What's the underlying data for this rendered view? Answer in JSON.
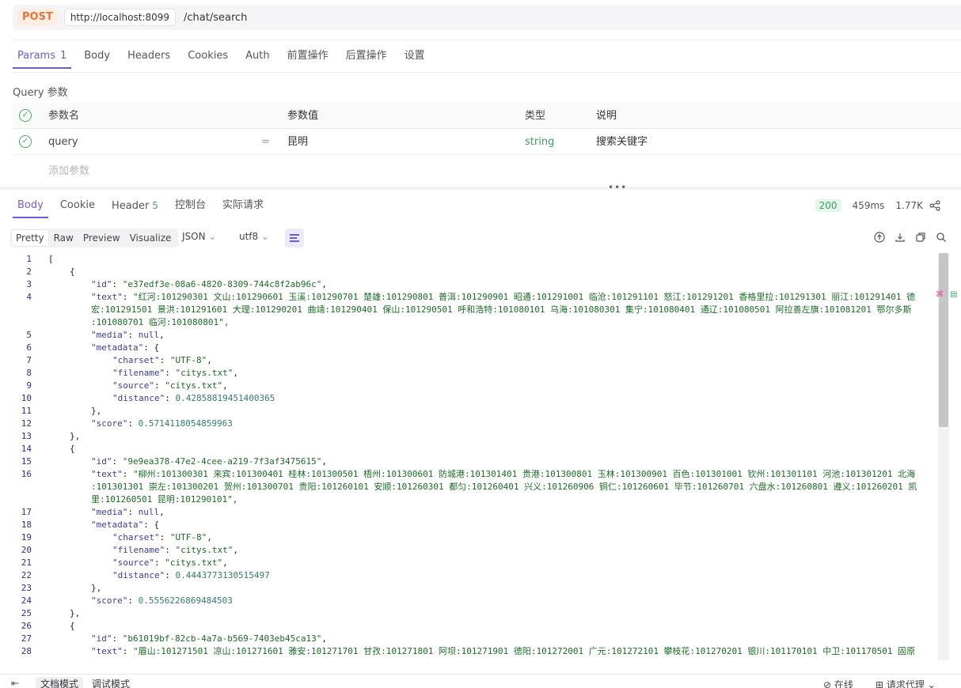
{
  "request": {
    "method": "POST",
    "host": "http://localhost:8099",
    "path": "/chat/search",
    "tabs": [
      {
        "label": "Params",
        "count": "1"
      },
      {
        "label": "Body"
      },
      {
        "label": "Headers"
      },
      {
        "label": "Cookies"
      },
      {
        "label": "Auth"
      },
      {
        "label": "前置操作"
      },
      {
        "label": "后置操作"
      },
      {
        "label": "设置"
      }
    ],
    "query_title": "Query 参数",
    "columns": {
      "name": "参数名",
      "value": "参数值",
      "type": "类型",
      "desc": "说明"
    },
    "param": {
      "name": "query",
      "eq": "=",
      "value": "昆明",
      "type": "string",
      "desc": "搜索关键字"
    },
    "add_param": "添加参数"
  },
  "response": {
    "tabs": [
      {
        "label": "Body"
      },
      {
        "label": "Cookie"
      },
      {
        "label": "Header",
        "count": "5"
      },
      {
        "label": "控制台"
      },
      {
        "label": "实际请求"
      }
    ],
    "status": "200",
    "time": "459ms",
    "size": "1.77K",
    "view_modes": [
      "Pretty",
      "Raw",
      "Preview",
      "Visualize"
    ],
    "format": "JSON",
    "encoding": "utf8"
  },
  "code_lines": [
    {
      "n": "1",
      "i": 0,
      "t": "["
    },
    {
      "n": "2",
      "i": 1,
      "t": "{"
    },
    {
      "n": "3",
      "i": 2,
      "k": "\"id\"",
      "v": "\"e37edf3e-08a6-4820-8309-744c8f2ab96c\"",
      "vt": "s",
      "e": ","
    },
    {
      "n": "4",
      "i": 2,
      "k": "\"text\"",
      "v": "\"红河:101290301 文山:101290601 玉溪:101290701 楚雄:101290801 普洱:101290901 昭通:101291001 临沧:101291101 怒江:101291201 香格里拉:101291301 丽江:101291401 德",
      "vt": "s"
    },
    {
      "n": "",
      "i": 2,
      "cont": "宏:101291501 景洪:101291601 大理:101290201 曲靖:101290401 保山:101290501 呼和浩特:101080101 乌海:101080301 集宁:101080401 通辽:101080501 阿拉善左旗:101081201 鄂尔多斯"
    },
    {
      "n": "",
      "i": 2,
      "cont": ":101080701 临河:101080801\","
    },
    {
      "n": "5",
      "i": 2,
      "k": "\"media\"",
      "v": "null",
      "vt": "k",
      "e": ","
    },
    {
      "n": "6",
      "i": 2,
      "k": "\"metadata\"",
      "v": "{",
      "vt": "p"
    },
    {
      "n": "7",
      "i": 3,
      "k": "\"charset\"",
      "v": "\"UTF-8\"",
      "vt": "s",
      "e": ","
    },
    {
      "n": "8",
      "i": 3,
      "k": "\"filename\"",
      "v": "\"citys.txt\"",
      "vt": "s",
      "e": ","
    },
    {
      "n": "9",
      "i": 3,
      "k": "\"source\"",
      "v": "\"citys.txt\"",
      "vt": "s",
      "e": ","
    },
    {
      "n": "10",
      "i": 3,
      "k": "\"distance\"",
      "v": "0.42858819451400365",
      "vt": "n"
    },
    {
      "n": "11",
      "i": 2,
      "t": "},"
    },
    {
      "n": "12",
      "i": 2,
      "k": "\"score\"",
      "v": "0.5714118054859963",
      "vt": "n"
    },
    {
      "n": "13",
      "i": 1,
      "t": "},"
    },
    {
      "n": "14",
      "i": 1,
      "t": "{"
    },
    {
      "n": "15",
      "i": 2,
      "k": "\"id\"",
      "v": "\"9e9ea378-47e2-4cee-a219-7f3af3475615\"",
      "vt": "s",
      "e": ","
    },
    {
      "n": "16",
      "i": 2,
      "k": "\"text\"",
      "v": "\"柳州:101300301 来宾:101300401 桂林:101300501 梧州:101300601 防城港:101301401 贵港:101300801 玉林:101300901 百色:101301001 钦州:101301101 河池:101301201 北海",
      "vt": "s"
    },
    {
      "n": "",
      "i": 2,
      "cont": ":101301301 崇左:101300201 贺州:101300701 贵阳:101260101 安顺:101260301 都匀:101260401 兴义:101260906 铜仁:101260601 毕节:101260701 六盘水:101260801 遵义:101260201 凯"
    },
    {
      "n": "",
      "i": 2,
      "cont": "里:101260501 昆明:101290101\","
    },
    {
      "n": "17",
      "i": 2,
      "k": "\"media\"",
      "v": "null",
      "vt": "k",
      "e": ","
    },
    {
      "n": "18",
      "i": 2,
      "k": "\"metadata\"",
      "v": "{",
      "vt": "p"
    },
    {
      "n": "19",
      "i": 3,
      "k": "\"charset\"",
      "v": "\"UTF-8\"",
      "vt": "s",
      "e": ","
    },
    {
      "n": "20",
      "i": 3,
      "k": "\"filename\"",
      "v": "\"citys.txt\"",
      "vt": "s",
      "e": ","
    },
    {
      "n": "21",
      "i": 3,
      "k": "\"source\"",
      "v": "\"citys.txt\"",
      "vt": "s",
      "e": ","
    },
    {
      "n": "22",
      "i": 3,
      "k": "\"distance\"",
      "v": "0.4443773130515497",
      "vt": "n"
    },
    {
      "n": "23",
      "i": 2,
      "t": "},"
    },
    {
      "n": "24",
      "i": 2,
      "k": "\"score\"",
      "v": "0.5556226869484503",
      "vt": "n"
    },
    {
      "n": "25",
      "i": 1,
      "t": "},"
    },
    {
      "n": "26",
      "i": 1,
      "t": "{"
    },
    {
      "n": "27",
      "i": 2,
      "k": "\"id\"",
      "v": "\"b61019bf-82cb-4a7a-b569-7403eb45ca13\"",
      "vt": "s",
      "e": ","
    },
    {
      "n": "28",
      "i": 2,
      "k": "\"text\"",
      "v": "\"眉山:101271501 凉山:101271601 雅安:101271701 甘孜:101271801 阿坝:101271901 德阳:101272001 广元:101272101 攀枝花:101270201 银川:101170101 中卫:101170501 固原",
      "vt": "s"
    }
  ],
  "footer": {
    "doc_mode": "文档模式",
    "debug_mode": "调试模式",
    "online": "在线",
    "proxy": "请求代理"
  },
  "colors": {
    "accent": "#6b5bd6",
    "method": "#e8763c",
    "ok": "#3eaa6d"
  }
}
